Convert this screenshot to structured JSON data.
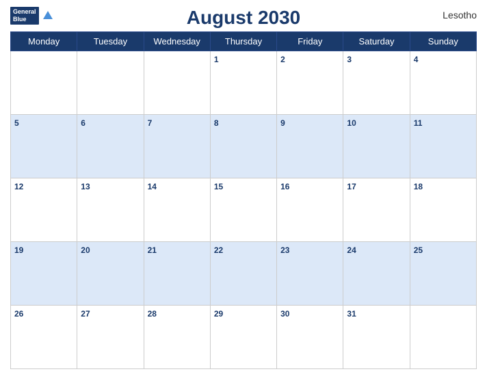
{
  "header": {
    "title": "August 2030",
    "country": "Lesotho",
    "logo_line1": "General",
    "logo_line2": "Blue"
  },
  "weekdays": [
    "Monday",
    "Tuesday",
    "Wednesday",
    "Thursday",
    "Friday",
    "Saturday",
    "Sunday"
  ],
  "weeks": [
    [
      null,
      null,
      null,
      1,
      2,
      3,
      4
    ],
    [
      5,
      6,
      7,
      8,
      9,
      10,
      11
    ],
    [
      12,
      13,
      14,
      15,
      16,
      17,
      18
    ],
    [
      19,
      20,
      21,
      22,
      23,
      24,
      25
    ],
    [
      26,
      27,
      28,
      29,
      30,
      31,
      null
    ]
  ]
}
